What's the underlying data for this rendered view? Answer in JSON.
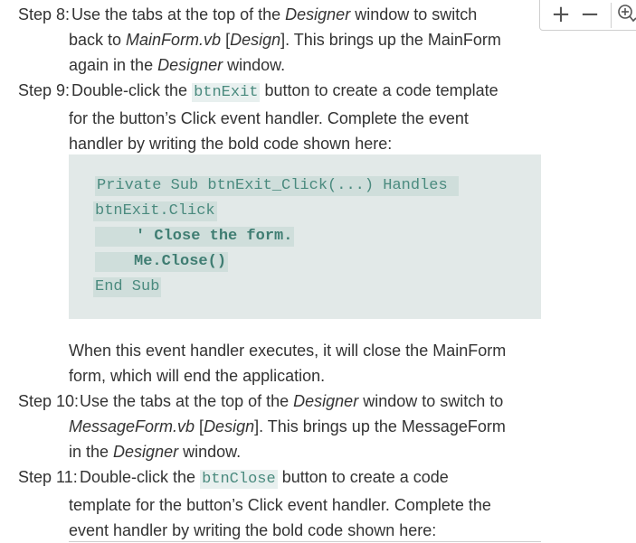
{
  "steps": {
    "s8": {
      "label": "Step 8:",
      "l1a": " Use the tabs at the top of the ",
      "l1b": "Designer",
      "l1c": " window to switch",
      "l2a": "back to ",
      "l2b": "MainForm.vb",
      "l2c": " [",
      "l2d": "Design",
      "l2e": "]. This brings up the MainForm",
      "l3a": "again in the ",
      "l3b": "Designer",
      "l3c": " window."
    },
    "s9": {
      "label": "Step 9:",
      "l1a": " Double-click the ",
      "l1code": "btnExit",
      "l1c": " button to create a code template",
      "l2": "for the button’s Click event handler. Complete the event",
      "l3": "handler by writing the bold code shown here:"
    },
    "code": {
      "line1": "Private Sub btnExit_Click(...) Handles ",
      "line2": "btnExit.Click",
      "line3": "' Close the form.",
      "line4": "Me.Close()",
      "line5": "End Sub"
    },
    "after_code": {
      "l1": "When this event handler executes, it will close the MainForm",
      "l2": "form, which will end the application."
    },
    "s10": {
      "label": "Step 10:",
      "l1a": "Use the tabs at the top of the ",
      "l1b": "Designer",
      "l1c": " window to switch to",
      "l2a": "MessageForm.vb",
      "l2b": " [",
      "l2c": "Design",
      "l2d": "]. This brings up the MessageForm",
      "l3a": "in the ",
      "l3b": "Designer",
      "l3c": " window."
    },
    "s11": {
      "label": "Step 11:",
      "l1a": "Double-click the ",
      "l1code": "btnClose",
      "l1c": " button to create a code",
      "l2": "template for the button’s Click event handler. Complete the",
      "l3": "event handler by writing the bold code shown here:"
    }
  },
  "zoom_controls": {
    "zoom_in": "+",
    "zoom_out": "−",
    "icons": [
      "plus-icon",
      "minus-icon",
      "zoom-magnifier-icon"
    ]
  },
  "colors": {
    "text": "#333333",
    "code_text": "#4a8a7e",
    "code_bg": "#e2e9e8",
    "inline_code_bg": "#e8f0ef"
  }
}
